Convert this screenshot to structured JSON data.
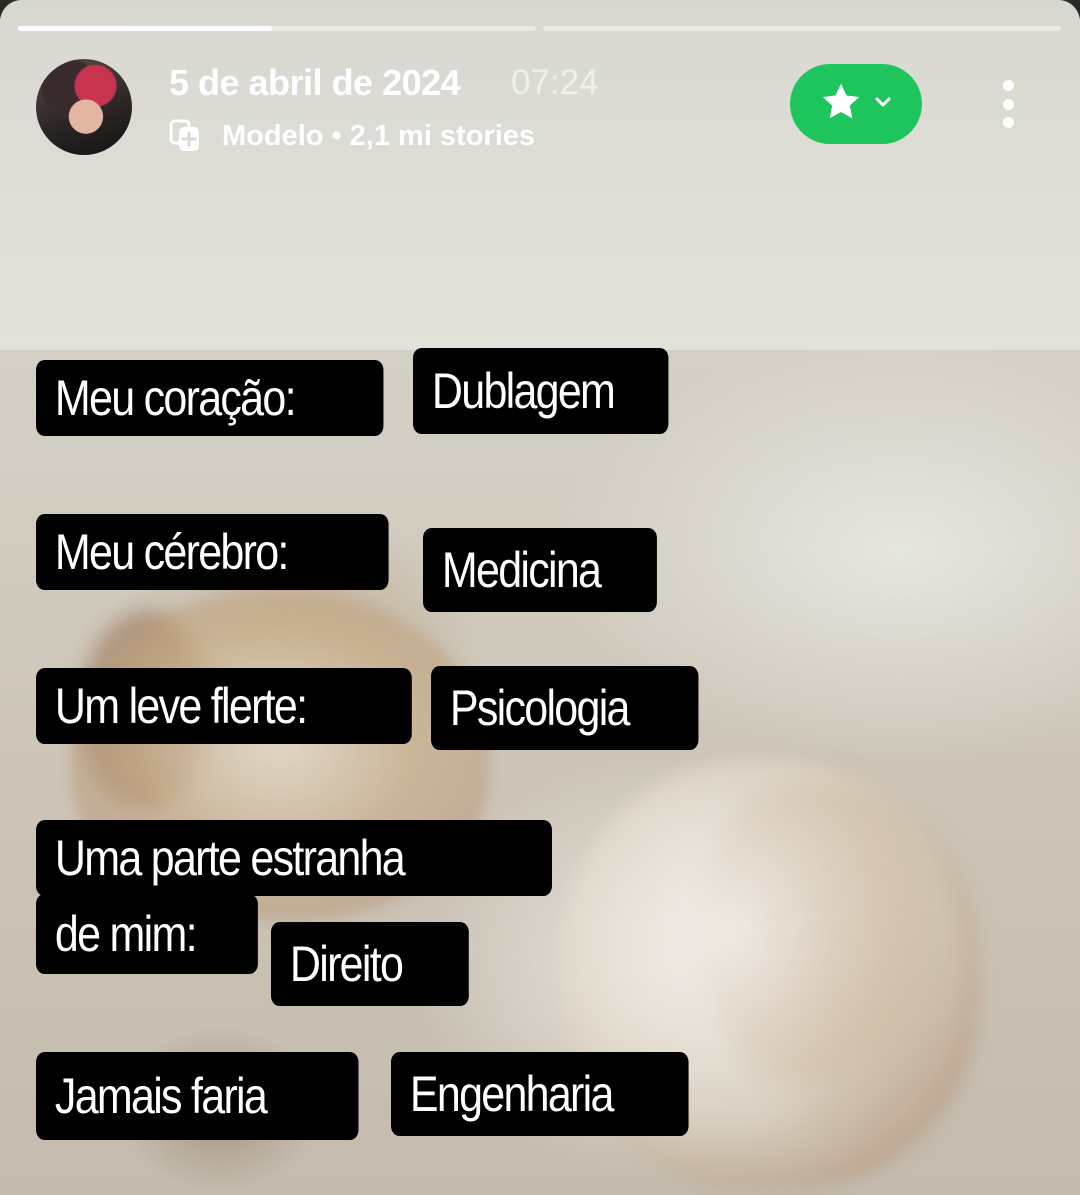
{
  "header": {
    "date": "5 de abril de 2024",
    "time": "07:24",
    "model_label": "Modelo",
    "separator": "•",
    "stories_count": "2,1 mi stories"
  },
  "progress": {
    "segments": [
      0.49,
      0
    ]
  },
  "icons": {
    "avatar": "profile-avatar",
    "model": "template-add-icon",
    "favorite": "star-icon",
    "dropdown": "chevron-down-icon",
    "more": "more-vertical-icon"
  },
  "colors": {
    "accent_green": "#1ec55c",
    "tag_background": "#000000",
    "tag_text": "#ffffff"
  },
  "meme": {
    "rows": [
      {
        "label": "Meu coração:",
        "answer": "Dublagem"
      },
      {
        "label": "Meu cérebro:",
        "answer": "Medicina"
      },
      {
        "label": "Um leve flerte:",
        "answer": "Psicologia"
      },
      {
        "label_line1": "Uma parte estranha",
        "label_line2": "de mim:",
        "answer": "Direito"
      },
      {
        "label": "Jamais faria",
        "answer": "Engenharia"
      }
    ]
  }
}
